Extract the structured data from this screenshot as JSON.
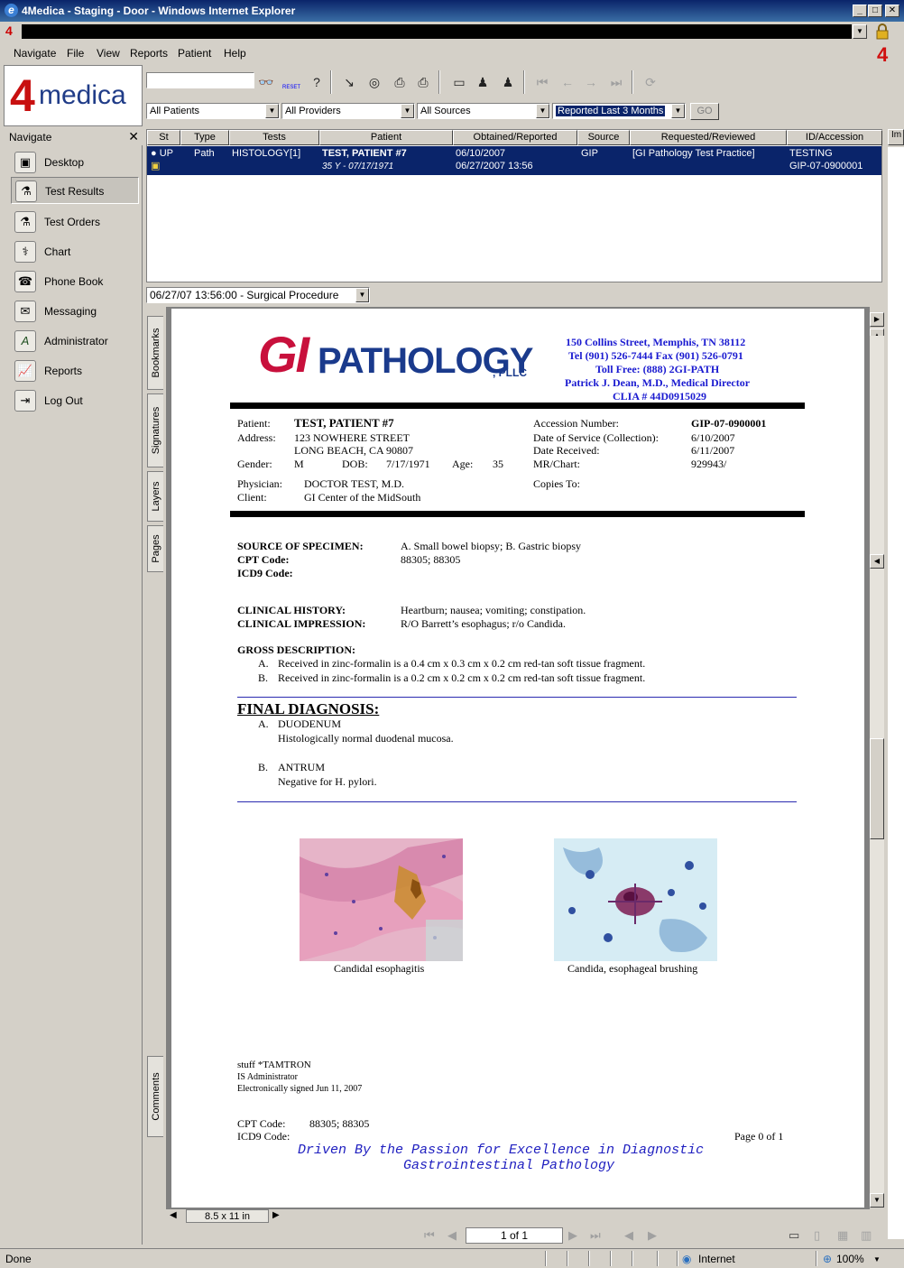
{
  "window": {
    "title": "4Medica - Staging - Door - Windows Internet Explorer"
  },
  "menu": {
    "items": [
      "Navigate",
      "File",
      "View",
      "Reports",
      "Patient",
      "Help"
    ],
    "brand_mark": "4"
  },
  "logo": {
    "four": "4",
    "medica": "medica"
  },
  "toolbar": {
    "search_value": "",
    "reset_label": "RESET"
  },
  "filters": {
    "patients": "All Patients",
    "providers": "All Providers",
    "sources": "All Sources",
    "period": "Reported Last 3 Months",
    "go_label": "GO"
  },
  "sidebar": {
    "title": "Navigate",
    "close": "✕",
    "items": [
      {
        "label": "Desktop",
        "icon": "desktop-icon"
      },
      {
        "label": "Test Results",
        "icon": "flask-icon"
      },
      {
        "label": "Test Orders",
        "icon": "flask-add-icon"
      },
      {
        "label": "Chart",
        "icon": "stethoscope-icon"
      },
      {
        "label": "Phone Book",
        "icon": "phone-icon"
      },
      {
        "label": "Messaging",
        "icon": "envelope-icon"
      },
      {
        "label": "Administrator",
        "icon": "admin-icon"
      },
      {
        "label": "Reports",
        "icon": "chart-icon"
      },
      {
        "label": "Log Out",
        "icon": "logout-icon"
      }
    ]
  },
  "results": {
    "headers": [
      "St",
      "Type",
      "Tests",
      "Patient",
      "Obtained/Reported",
      "Source",
      "Requested/Reviewed",
      "ID/Accession"
    ],
    "extra_header": "Im",
    "row": {
      "status": "UP",
      "type": "Path",
      "tests": "HISTOLOGY[1]",
      "patient": "TEST, PATIENT #7",
      "patient_sub": "35 Y - 07/17/1971",
      "obtained": "06/10/2007",
      "reported": "06/27/2007 13:56",
      "source": "GIP",
      "requested": "[GI Pathology Test Practice]",
      "id": "TESTING",
      "accession": "GIP-07-0900001"
    }
  },
  "procedure_select": "06/27/07 13:56:00 - Surgical Procedure",
  "side_tabs": [
    "Bookmarks",
    "Signatures",
    "Layers",
    "Pages",
    "Comments"
  ],
  "report": {
    "logo_gi": "GI",
    "logo_pathology": "PATHOLOGY",
    "logo_pllc": ", PLLC",
    "header_lines": [
      "150 Collins Street, Memphis, TN  38112",
      "Tel (901) 526-7444  Fax (901) 526-0791",
      "Toll Free: (888) 2GI-PATH",
      "Patrick J. Dean, M.D., Medical Director",
      "CLIA # 44D0915029"
    ],
    "patient_label": "Patient:",
    "patient_name": "TEST, PATIENT #7",
    "address_label": "Address:",
    "address1": "123 NOWHERE STREET",
    "address2": "LONG BEACH, CA 90807",
    "gender_label": "Gender:",
    "gender": "M",
    "dob_label": "DOB:",
    "dob": "7/17/1971",
    "age_label": "Age:",
    "age": "35",
    "physician_label": "Physician:",
    "physician": "DOCTOR  TEST, M.D.",
    "client_label": "Client:",
    "client": "GI Center of the MidSouth",
    "accession_label": "Accession Number:",
    "accession": "GIP-07-0900001",
    "dos_label": "Date of Service (Collection):",
    "dos": "6/10/2007",
    "received_label": "Date Received:",
    "received": "6/11/2007",
    "mr_label": "MR/Chart:",
    "mr": "929943/",
    "copies_label": "Copies To:",
    "source_label": "SOURCE OF SPECIMEN:",
    "source": "A. Small bowel biopsy; B. Gastric biopsy",
    "cpt_label": "CPT Code:",
    "cpt": "88305; 88305",
    "icd_label": "ICD9 Code:",
    "history_label": "CLINICAL HISTORY:",
    "history": "Heartburn; nausea; vomiting; constipation.",
    "impression_label": "CLINICAL IMPRESSION:",
    "impression": "R/O Barrett’s esophagus; r/o Candida.",
    "gross_label": "GROSS DESCRIPTION:",
    "gross_a_letter": "A.",
    "gross_a": "Received in zinc-formalin is a 0.4 cm x 0.3 cm x 0.2 cm red-tan soft tissue fragment.",
    "gross_b_letter": "B.",
    "gross_b": "Received in zinc-formalin is a 0.2 cm x 0.2 cm x 0.2 cm red-tan soft tissue fragment.",
    "final_label": "FINAL DIAGNOSIS:",
    "dx_a_letter": "A.",
    "dx_a_title": "DUODENUM",
    "dx_a_text": "Histologically normal duodenal mucosa.",
    "dx_b_letter": "B.",
    "dx_b_title": "ANTRUM",
    "dx_b_text": "Negative for H. pylori.",
    "image1_caption": "Candidal esophagitis",
    "image2_caption": "Candida, esophageal brushing",
    "sig1": "stuff  *TAMTRON",
    "sig2": "IS Administrator",
    "sig3": "Electronically signed Jun 11, 2007",
    "footer_cpt_label": "CPT Code:",
    "footer_cpt": "88305; 88305",
    "footer_icd_label": "ICD9 Code:",
    "page_label": "Page 0 of 1",
    "tagline1": "Driven By the Passion for Excellence in Diagnostic",
    "tagline2": "Gastrointestinal Pathology"
  },
  "viewer": {
    "page_size": "8.5 x 11 in",
    "page_indicator": "1 of 1"
  },
  "status": {
    "left": "Done",
    "zone": "Internet",
    "zoom": "100%"
  }
}
